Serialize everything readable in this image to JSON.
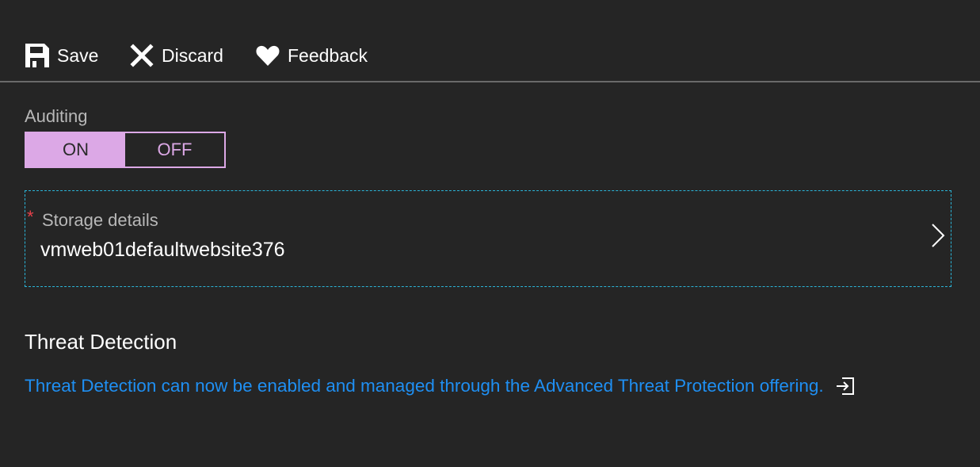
{
  "toolbar": {
    "save_label": "Save",
    "save_icon": "save-icon",
    "discard_label": "Discard",
    "discard_icon": "close-icon",
    "feedback_label": "Feedback",
    "feedback_icon": "heart-icon"
  },
  "auditing": {
    "label": "Auditing",
    "on_label": "ON",
    "off_label": "OFF",
    "selected": "ON",
    "accent_color": "#dca8e6"
  },
  "storage": {
    "required_marker": "*",
    "label": "Storage details",
    "value": "vmweb01defaultwebsite376",
    "chevron_icon": "chevron-right-icon"
  },
  "threat_detection": {
    "title": "Threat Detection",
    "link_text": "Threat Detection can now be enabled and managed through the Advanced Threat Protection offering.",
    "link_icon": "open-external-icon",
    "link_color": "#1f8ff2"
  }
}
